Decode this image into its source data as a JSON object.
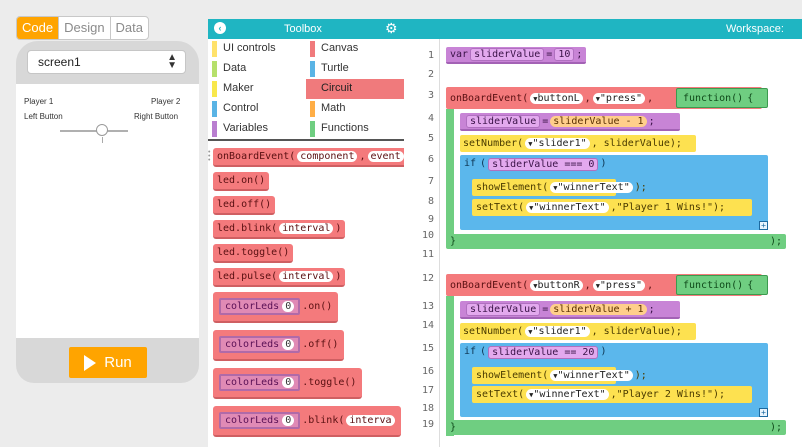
{
  "modes": {
    "code": "Code",
    "design": "Design",
    "data": "Data"
  },
  "screen_select": {
    "value": "screen1"
  },
  "app": {
    "player1": "Player 1",
    "player2": "Player 2",
    "left_button": "Left Button",
    "right_button": "Right Button",
    "slider_value": 10
  },
  "run_label": "Run",
  "toolbox": {
    "title": "Toolbox",
    "categories": [
      {
        "label": "UI controls",
        "color": "#ffe26b"
      },
      {
        "label": "Canvas",
        "color": "#f07a7c"
      },
      {
        "label": "Data",
        "color": "#b6e06b"
      },
      {
        "label": "Turtle",
        "color": "#5ab4e5"
      },
      {
        "label": "Maker",
        "color": "#f8e84c"
      },
      {
        "label": "Circuit",
        "color": "#f07a7c"
      },
      {
        "label": "Control",
        "color": "#5ab4e5"
      },
      {
        "label": "Math",
        "color": "#ffae46"
      },
      {
        "label": "Variables",
        "color": "#b97ed0"
      },
      {
        "label": "Functions",
        "color": "#6fce81"
      }
    ],
    "blocks": {
      "b0_name": "onBoardEvent(",
      "b0_a1": "component",
      "b0_a2": "event",
      "b1": "led.on()",
      "b2": "led.off()",
      "b3_name": "led.blink(",
      "b3_arg": "interval",
      "b3_end": ")",
      "b4": "led.toggle()",
      "b5_name": "led.pulse(",
      "b5_arg": "interval",
      "b5_end": ")",
      "c_name": "colorLeds",
      "c_idx": "0",
      "c1": ".on()",
      "c2": ".off()",
      "c3": ".toggle()",
      "c4_name": ".blink(",
      "c4_arg": "interva"
    }
  },
  "workspace": {
    "title": "Workspace:",
    "lines": [
      "1",
      "2",
      "3",
      "4",
      "5",
      "6",
      "7",
      "8",
      "9",
      "10",
      "11",
      "12",
      "13",
      "14",
      "15",
      "16",
      "17",
      "18",
      "19"
    ],
    "code": {
      "var": "var",
      "varname": "sliderValue",
      "eq": "=",
      "init": "10",
      "semi": ";",
      "ev": "onBoardEvent(",
      "btnL": "buttonL",
      "btnR": "buttonR",
      "press": "\"press\"",
      "comma": ",",
      "fn": "function()",
      "brace_open": "{",
      "sv": "sliderValue",
      "minus": "sliderValue - 1",
      "plus": "sliderValue + 1",
      "setnum": "setNumber(",
      "slider1": "\"slider1\"",
      "setnum_end": ", sliderValue);",
      "if_kw": "if",
      "cond1": "sliderValue === 0",
      "cond2": "sliderValue == 20",
      "if_end": ")",
      "show": "showElement(",
      "winnertext": "\"winnerText\"",
      "show_end": ");",
      "settext": "setText(",
      "p1": ",\"Player 1 Wins!\");",
      "p2": ",\"Player 2 Wins!\");",
      "close": "}",
      "close_paren": ");",
      "plus_icon": "+",
      "dd": "▼"
    }
  }
}
